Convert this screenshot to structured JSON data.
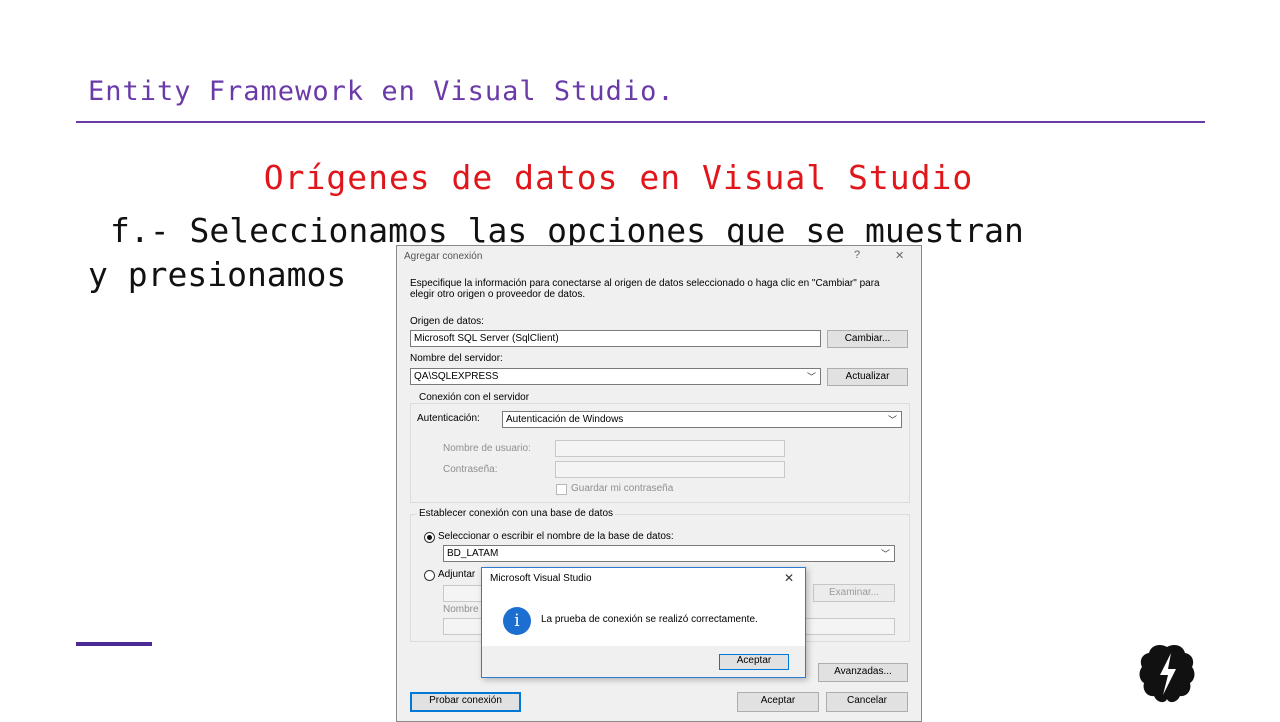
{
  "slide": {
    "title": "Entity Framework en Visual Studio.",
    "subtitle": "Orígenes de datos en Visual Studio",
    "body_line1": "f.- Seleccionamos las opciones que se muestran",
    "body_line2": "y presionamos"
  },
  "colors": {
    "title": "#6a3aa8",
    "subtitle": "#e0161b",
    "accent": "#4b2a96",
    "dialog_blue": "#0078d7"
  },
  "dialog": {
    "title": "Agregar conexión",
    "help": "?",
    "close": "✕",
    "description": "Especifique la información para conectarse al origen de datos seleccionado o haga clic en \"Cambiar\" para elegir otro origen o proveedor de datos.",
    "origin_label": "Origen de datos:",
    "origin_value": "Microsoft SQL Server (SqlClient)",
    "change_button": "Cambiar...",
    "server_label": "Nombre del servidor:",
    "server_value": "QA\\SQLEXPRESS",
    "refresh_button": "Actualizar",
    "server_group": "Conexión con el servidor",
    "auth_label": "Autenticación:",
    "auth_value": "Autenticación de Windows",
    "username_label": "Nombre de usuario:",
    "password_label": "Contraseña:",
    "save_password_label": "Guardar mi contraseña",
    "db_group": "Establecer conexión con una base de datos",
    "select_db_label": "Seleccionar o escribir el nombre de la base de datos:",
    "db_value": "BD_LATAM",
    "attach_label": "Adjuntar",
    "browse_button": "Examinar...",
    "logical_name_label": "Nombre",
    "advanced_button": "Avanzadas...",
    "test_button": "Probar conexión",
    "ok_button": "Aceptar",
    "cancel_button": "Cancelar"
  },
  "message_box": {
    "title": "Microsoft Visual Studio",
    "close": "✕",
    "message": "La prueba de conexión se realizó correctamente.",
    "ok_button": "Aceptar",
    "icon": "info-icon"
  }
}
